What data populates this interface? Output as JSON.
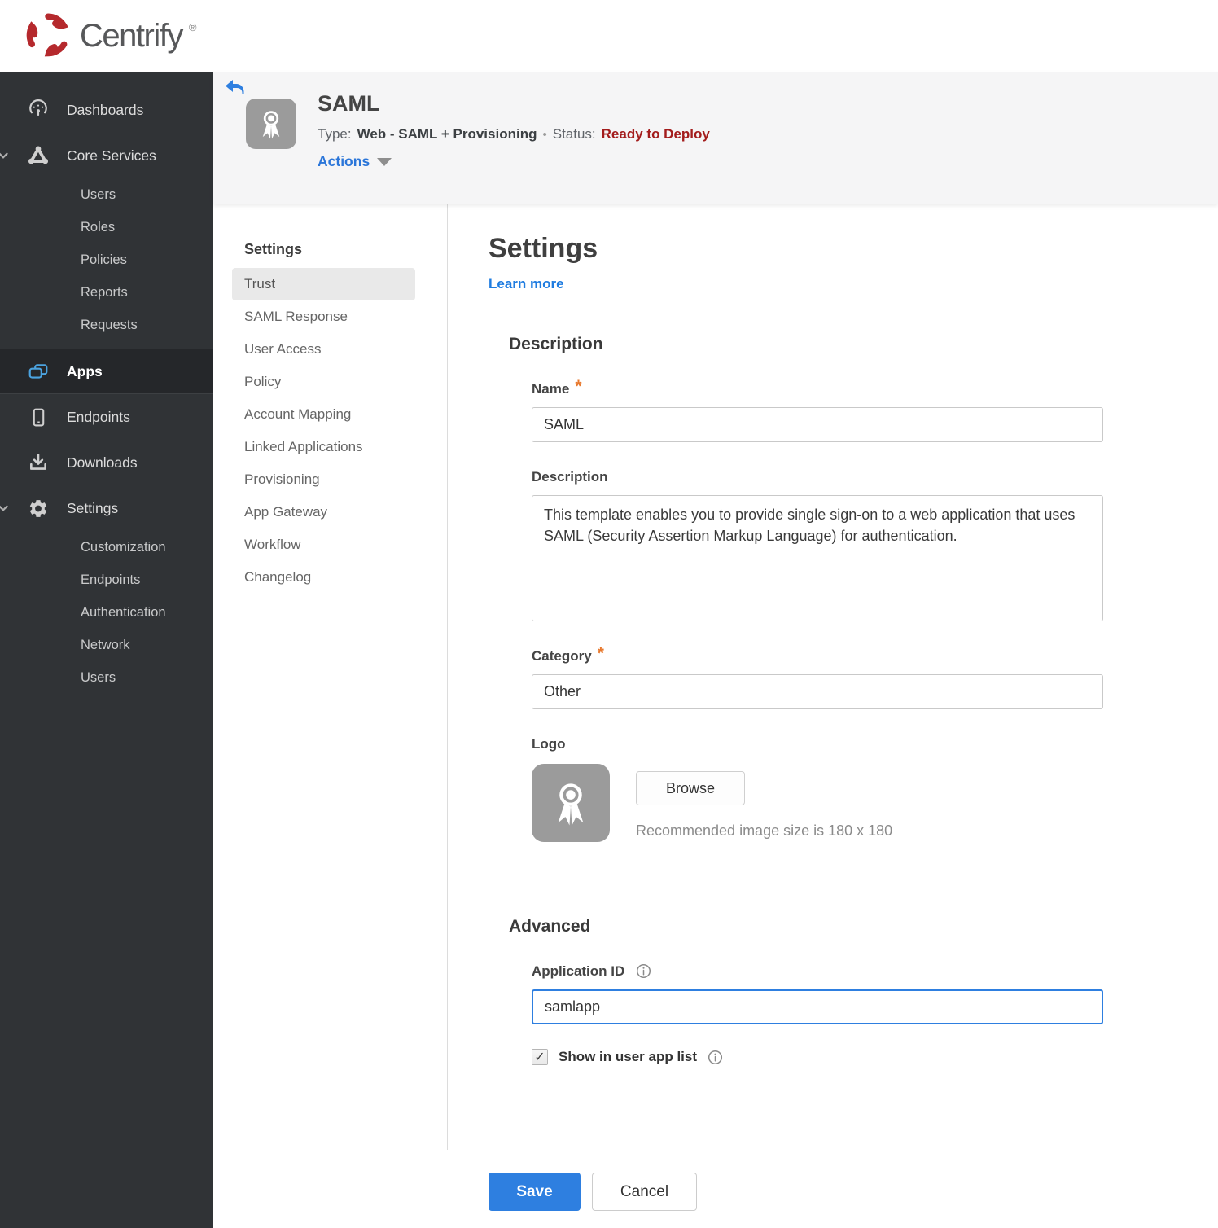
{
  "brand": {
    "name": "Centrify",
    "reg": "®"
  },
  "sidebar": {
    "dashboards": "Dashboards",
    "core_services": "Core Services",
    "core_items": [
      "Users",
      "Roles",
      "Policies",
      "Reports",
      "Requests"
    ],
    "apps": "Apps",
    "endpoints": "Endpoints",
    "downloads": "Downloads",
    "settings": "Settings",
    "settings_items": [
      "Customization",
      "Endpoints",
      "Authentication",
      "Network",
      "Users"
    ]
  },
  "header": {
    "title": "SAML",
    "type_label": "Type:",
    "type_value": "Web - SAML + Provisioning",
    "separator": "•",
    "status_label": "Status:",
    "status_value": "Ready to Deploy",
    "actions_label": "Actions"
  },
  "subnav": {
    "heading": "Settings",
    "selected": "Trust",
    "items": [
      "Trust",
      "SAML Response",
      "User Access",
      "Policy",
      "Account Mapping",
      "Linked Applications",
      "Provisioning",
      "App Gateway",
      "Workflow",
      "Changelog"
    ]
  },
  "main": {
    "title": "Settings",
    "learn_more": "Learn more",
    "required_marker": "*",
    "description_section": {
      "heading": "Description",
      "name_label": "Name",
      "name_value": "SAML",
      "description_label": "Description",
      "description_value": "This template enables you to provide single sign-on to a web application that uses SAML (Security Assertion Markup Language) for authentication.",
      "category_label": "Category",
      "category_value": "Other",
      "logo_label": "Logo",
      "browse_button": "Browse",
      "logo_hint": "Recommended image size is 180 x 180"
    },
    "advanced_section": {
      "heading": "Advanced",
      "app_id_label": "Application ID",
      "app_id_value": "samlapp",
      "check_glyph": "✓",
      "show_in_app_list_label": "Show in user app list"
    },
    "footer": {
      "save": "Save",
      "cancel": "Cancel"
    }
  },
  "colors": {
    "accent_blue": "#2e7fe0",
    "link_blue": "#1f7ce0",
    "status_red": "#a31c1c",
    "required_orange": "#e8792e",
    "sidebar_bg": "#303336",
    "sidebar_active_bg": "#25272a",
    "header_band_bg": "#f5f5f6",
    "brand_red": "#b5292d",
    "apps_icon_blue": "#4ba3e0"
  }
}
